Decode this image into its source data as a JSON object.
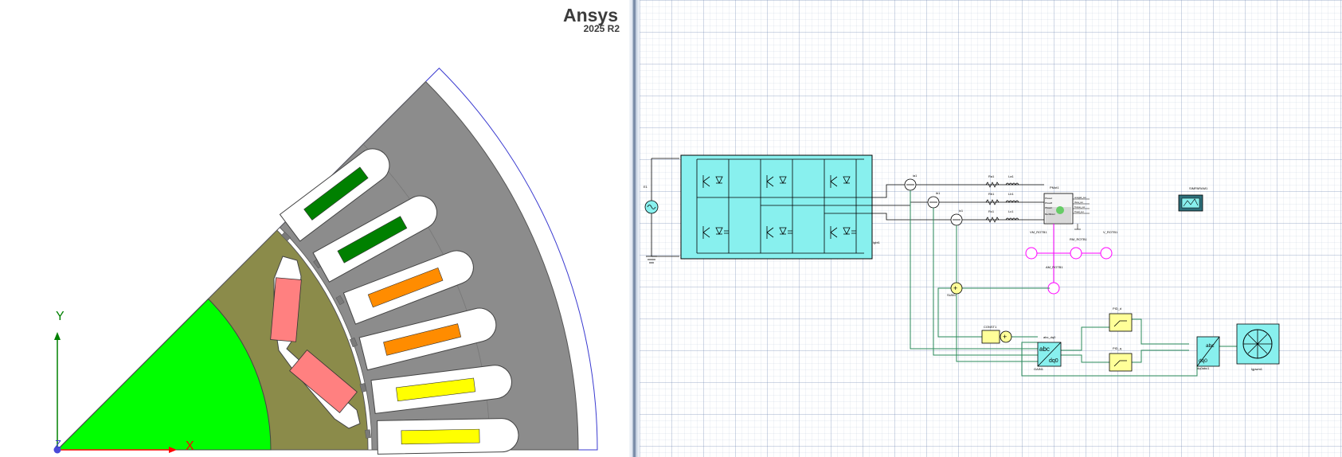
{
  "brand": {
    "title": "Ansys",
    "version": "2025 R2"
  },
  "geometry_view": {
    "axis_labels": {
      "x": "X",
      "y": "Y",
      "z": "Z"
    },
    "colors": {
      "rotor_core": "#00ff00",
      "rotor_lamination": "#8b8b4a",
      "magnet": "#ff8080",
      "stator": "#8c8c8c",
      "slot": "#ffffff",
      "winding_phase_a": "#008000",
      "winding_phase_b": "#ff8c00",
      "winding_phase_c": "#ffff00",
      "boundary": "#3a3ad0",
      "axis_x": "#ff0000",
      "axis_y": "#008000"
    }
  },
  "schematic": {
    "labels": {
      "inverter": "Igbt1",
      "source": "E1",
      "phase_sensor_1": "ia1",
      "phase_sensor_2": "ib1",
      "phase_sensor_3": "ic1",
      "resistor_1": "Ra1",
      "resistor_2": "Rb1",
      "resistor_3": "Rc1",
      "inductor_1": "La1",
      "inductor_2": "Lb1",
      "inductor_3": "Lc1",
      "machine": "PMot1",
      "machine_port_1": "PhaseA",
      "machine_port_2": "PhaseB",
      "machine_port_3": "PhaseC",
      "machine_port_4": "MechRotor",
      "machine_out_1": "omega1_out",
      "machine_out_2": "theta_out",
      "machine_out_3": "Torque_out",
      "machine_out_4": "Tload_out",
      "sim_params": "SIMPARAM1",
      "speed_source": "VM_ROTB1",
      "speed_meter": "RM_ROTB1",
      "torque_meter": "V_ROTB1",
      "angle_source": "AM_ROTB1",
      "sum_1": "SUM1",
      "gain_1": "GAIN1",
      "abc_dq0": "abc_dq0",
      "pi_d": "PID_d",
      "pi_q": "PID_q",
      "dq0_abc": "dq0abc1",
      "pwm": "Igpwm1",
      "const_1": "CONST1"
    },
    "colors": {
      "block_fill": "#88f0ee",
      "controller_fill": "#ffff99",
      "signal_wire": "#2a8a5a",
      "mech_wire": "#ff00ff",
      "electrical_wire": "#000000"
    }
  }
}
